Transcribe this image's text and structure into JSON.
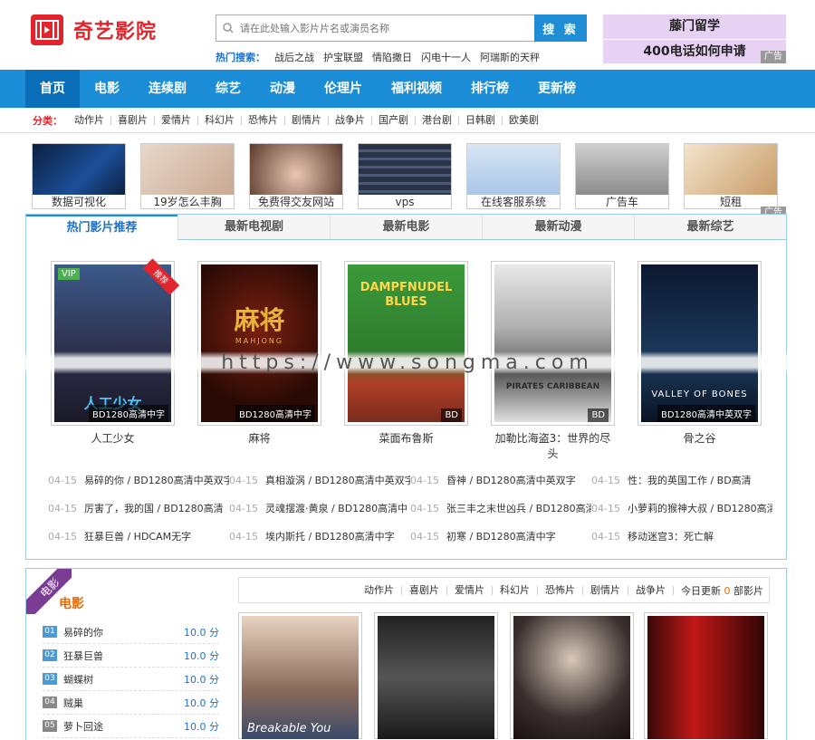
{
  "site": {
    "name": "奇艺影院"
  },
  "search": {
    "placeholder": "请在此处输入影片片名或演员名称",
    "button": "搜 索",
    "hot_label": "热门搜索：",
    "hot": [
      "战后之战",
      "护宝联盟",
      "情陷撒日",
      "闪电十一人",
      "阿瑞斯的天秤"
    ]
  },
  "top_ad": {
    "line1": "藤门留学",
    "line2": "400电话如何申请",
    "tag": "广告"
  },
  "nav": [
    "首页",
    "电影",
    "连续剧",
    "综艺",
    "动漫",
    "伦理片",
    "福利视频",
    "排行榜",
    "更新榜"
  ],
  "categories": {
    "label": "分类：",
    "items": [
      "动作片",
      "喜剧片",
      "爱情片",
      "科幻片",
      "恐怖片",
      "剧情片",
      "战争片",
      "国产剧",
      "港台剧",
      "日韩剧",
      "欧美剧"
    ]
  },
  "ad_strip": {
    "items": [
      "数据可视化",
      "19岁怎么丰胸",
      "免费得交友网站",
      "vps",
      "在线客服系统",
      "广告车",
      "短租"
    ],
    "tag": "广告"
  },
  "tabs": [
    "热门影片推荐",
    "最新电视剧",
    "最新电影",
    "最新动漫",
    "最新综艺"
  ],
  "featured": [
    {
      "title": "人工少女",
      "quality": "BD1280高清中字",
      "badge": "VIP",
      "corner": "推荐"
    },
    {
      "title": "麻将",
      "quality": "BD1280高清中字"
    },
    {
      "title": "菜面布鲁斯",
      "quality": "BD"
    },
    {
      "title": "加勒比海盗3：世界的尽头",
      "quality": "BD"
    },
    {
      "title": "骨之谷",
      "quality": "BD1280高清中英双字"
    }
  ],
  "poster_text": {
    "p1": "人工少女",
    "p2": "麻将",
    "p2sub": "MAHJONG",
    "p3a": "DAMPFNUDEL",
    "p3b": "BLUES",
    "p4": "PIRATES CARIBBEAN",
    "p5": "VALLEY OF BONES"
  },
  "news": [
    [
      {
        "d": "04-15",
        "t": "易碎的你 / BD1280高清中英双字"
      },
      {
        "d": "04-15",
        "t": "真相漩涡 / BD1280高清中英双字"
      },
      {
        "d": "04-15",
        "t": "昏神 / BD1280高清中英双字"
      },
      {
        "d": "04-15",
        "t": "性：我的英国工作 / BD高清"
      }
    ],
    [
      {
        "d": "04-15",
        "t": "厉害了，我的国 / BD1280高清"
      },
      {
        "d": "04-15",
        "t": "灵魂摆渡·黄泉 / BD1280高清中"
      },
      {
        "d": "04-15",
        "t": "张三丰之末世凶兵 / BD1280高清"
      },
      {
        "d": "04-15",
        "t": "小萝莉的猴神大叔 / BD1280高清"
      }
    ],
    [
      {
        "d": "04-15",
        "t": "狂暴巨兽 / HDCAM无字"
      },
      {
        "d": "04-15",
        "t": "埃内斯托 / BD1280高清中字"
      },
      {
        "d": "04-15",
        "t": "初寒 / BD1280高清中字"
      },
      {
        "d": "04-15",
        "t": "移动迷宫3：死亡解"
      }
    ]
  ],
  "movie_section": {
    "ribbon": "电影",
    "title": "电影",
    "subcats": [
      "动作片",
      "喜剧片",
      "爱情片",
      "科幻片",
      "恐怖片",
      "剧情片",
      "战争片"
    ],
    "update_prefix": "今日更新",
    "update_count": "0",
    "update_suffix": "部影片",
    "rank": [
      {
        "n": "01",
        "t": "易碎的你",
        "s": "10.0 分"
      },
      {
        "n": "02",
        "t": "狂暴巨兽",
        "s": "10.0 分"
      },
      {
        "n": "03",
        "t": "蝴蝶树",
        "s": "10.0 分"
      },
      {
        "n": "04",
        "t": "贼巢",
        "s": "10.0 分"
      },
      {
        "n": "05",
        "t": "萝卜回途",
        "s": "10.0 分"
      }
    ],
    "poster_text": [
      "Breakable You"
    ]
  },
  "watermark": "https://www.songma.com",
  "colors": {
    "brand": "#e2252c",
    "nav": "#1a8dd6",
    "link": "#1e70c8"
  }
}
